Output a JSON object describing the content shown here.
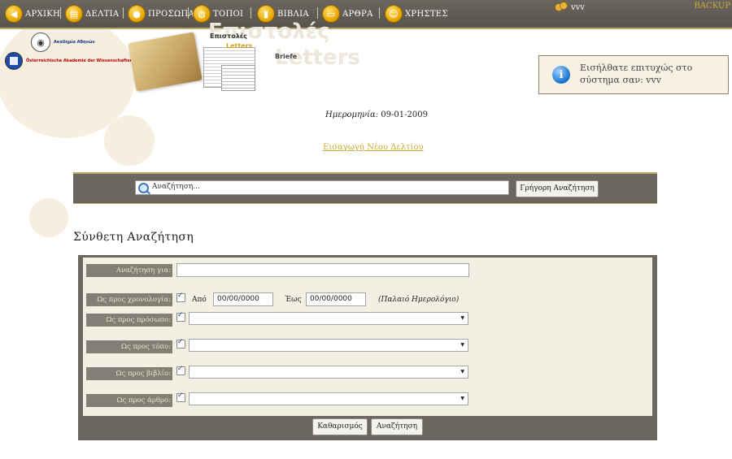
{
  "nav": {
    "items": [
      {
        "label": "ΑΡΧΙΚΗ",
        "icon": "arrow-home-icon"
      },
      {
        "label": "ΔΕΛΤΙΑ",
        "icon": "cards-icon"
      },
      {
        "label": "ΠΡΟΣΩΠΑ",
        "icon": "person-icon"
      },
      {
        "label": "ΤΟΠΟΙ",
        "icon": "globe-icon"
      },
      {
        "label": "ΒΙΒΛΙΑ",
        "icon": "book-icon"
      },
      {
        "label": "ΑΡΘΡΑ",
        "icon": "open-book-icon"
      },
      {
        "label": "ΧΡΗΣΤΕΣ",
        "icon": "users-icon"
      }
    ],
    "user": "vvv",
    "backup": "BACKUP"
  },
  "header": {
    "academy_name": "Ακαδημία Αθηνών",
    "austria_name": "Österreichische Akademie der Wissenschaften",
    "banner_words": {
      "greek": "Επιστολές",
      "english": "Letters",
      "german": "Briefe"
    },
    "login_message": "Εισήλθατε επιτυχώς στο σύστημα σαν: vvv"
  },
  "page": {
    "date_label": "Ημερομηνία:",
    "date_value": "09-01-2009",
    "new_entry_link": "Εισαγωγή Νέου Δελτίου"
  },
  "quick_search": {
    "placeholder": "Αναζήτηση...",
    "button": "Γρήγορη Αναζήτηση"
  },
  "advanced": {
    "title": "Σύνθετη Αναζήτηση",
    "search_for_label": "Αναζήτηση για:",
    "search_for_value": "",
    "chronology_label": "Ως προς χρονολογία:",
    "from_label": "Από",
    "from_value": "00/00/0000",
    "to_label": "Έως",
    "to_value": "00/00/0000",
    "calendar_note": "(Παλαιό Ημερολόγιο)",
    "person_label": "Ως προς πρόσωπο:",
    "place_label": "Ως προς τόπο:",
    "book_label": "Ως προς βιβλίο:",
    "article_label": "Ως προς άρθρο:",
    "clear_button": "Καθαρισμός",
    "search_button": "Αναζήτηση"
  },
  "colors": {
    "nav_bg": "#57534d",
    "accent_gold": "#b8a66a",
    "form_bg": "#f2efe3",
    "label_bg": "#847f74",
    "link": "#c9a832"
  }
}
